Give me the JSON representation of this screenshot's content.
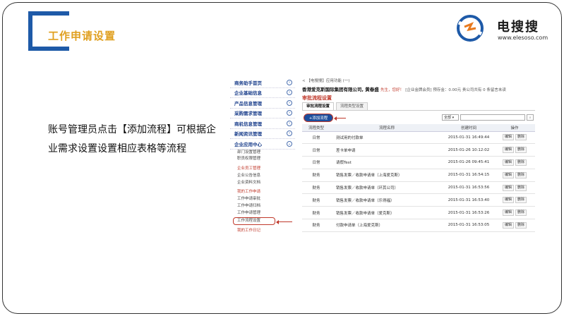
{
  "slide": {
    "title": "工作申请设置",
    "description": "账号管理员点击【添加流程】可根据企业需求设置设置相应表格等流程",
    "logo": {
      "name": "电搜搜",
      "url": "www.elesoso.com"
    }
  },
  "sidebar": {
    "heads": [
      "商务助手首页",
      "企业基础信息",
      "产品信息管理",
      "采购需求管理",
      "商机信息管理",
      "新闻资讯管理",
      "企业应用中心"
    ],
    "group1": [
      "部门设置管理",
      "职员权限管理"
    ],
    "group2": [
      "企业员工管理",
      "企业公告信息",
      "企业资料文档"
    ],
    "group3": [
      "我的工作申请",
      "工作申请审批",
      "工作申请归档",
      "工作申请管理",
      "工作流程设置"
    ],
    "group4": [
      "我的工作日记"
    ]
  },
  "content": {
    "breadcrumb": "< 【电搜搜】应用功能 (一)",
    "company": "香港爱克斯国际集团有限公司, 黄春盛",
    "greeting": "先生，您好！",
    "meta": "[企业金牌会员] 预存金：0.00元  贵公司共有 0 条留言未读",
    "section_title": "审批流程设置",
    "tabs": [
      "审批流程设置",
      "流程类型设置"
    ],
    "add_button": "+添加流程",
    "filter_value": "全部 ▾",
    "search_icon": "search-icon",
    "columns": [
      "流程类型",
      "流程名称",
      "创建时间",
      "操作"
    ],
    "rows": [
      {
        "type": "日常",
        "name": "测试用的付款单",
        "time": "2015-01-31 16:49:44"
      },
      {
        "type": "日常",
        "name": "差卡单申请",
        "time": "2015-01-26 10:12:02"
      },
      {
        "type": "日常",
        "name": "请假Test",
        "time": "2015-01-26 09:45:41"
      },
      {
        "type": "财务",
        "name": "销售发票／收款申请单（上海爱克斯）",
        "time": "2015-01-31 16:54:15"
      },
      {
        "type": "财务",
        "name": "销售发票／收款申请单（环其公司）",
        "time": "2015-01-31 16:53:56"
      },
      {
        "type": "财务",
        "name": "销售发票／收款申请单（乐得福）",
        "time": "2015-01-31 16:53:40"
      },
      {
        "type": "财务",
        "name": "销售发票／收款申请单（爱克斯）",
        "time": "2015-01-31 16:53:26"
      },
      {
        "type": "财务",
        "name": "付款申请单（上海爱克斯）",
        "time": "2015-01-31 16:53:05"
      }
    ],
    "edit_label": "编辑",
    "delete_label": "删除"
  }
}
